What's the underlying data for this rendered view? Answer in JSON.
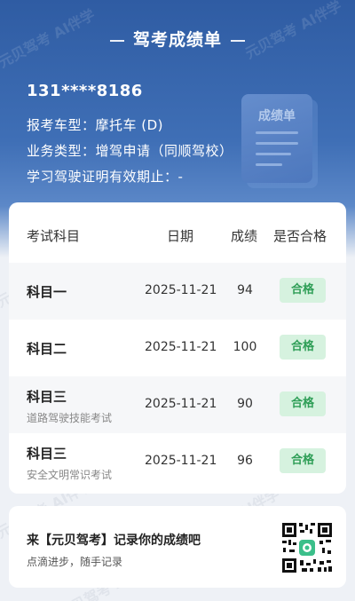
{
  "header": {
    "title": "驾考成绩单",
    "phone": "131****8186",
    "vehicle_type": "报考车型：摩托车 (D)",
    "business_type": "业务类型：增驾申请（同顺驾校）",
    "license_expiry": "学习驾驶证明有效期止：-",
    "illustration_label": "成绩单"
  },
  "table": {
    "headers": {
      "subject": "考试科目",
      "date": "日期",
      "score": "成绩",
      "pass": "是否合格"
    },
    "rows": [
      {
        "subject": "科目一",
        "subtitle": "",
        "date": "2025-11-21",
        "score": "94",
        "result": "合格"
      },
      {
        "subject": "科目二",
        "subtitle": "",
        "date": "2025-11-21",
        "score": "100",
        "result": "合格"
      },
      {
        "subject": "科目三",
        "subtitle": "道路驾驶技能考试",
        "date": "2025-11-21",
        "score": "90",
        "result": "合格"
      },
      {
        "subject": "科目三",
        "subtitle": "安全文明常识考试",
        "date": "2025-11-21",
        "score": "96",
        "result": "合格"
      }
    ]
  },
  "promo": {
    "title": "来【元贝驾考】记录你的成绩吧",
    "subtitle": "点滴进步，随手记录"
  },
  "watermark": "元贝驾考 AI伴学",
  "colors": {
    "header_blue": "#2f5ca3",
    "pass_badge_bg": "#d6f2df",
    "pass_badge_text": "#2e9e56",
    "qr_center": "#3bbf8a"
  }
}
